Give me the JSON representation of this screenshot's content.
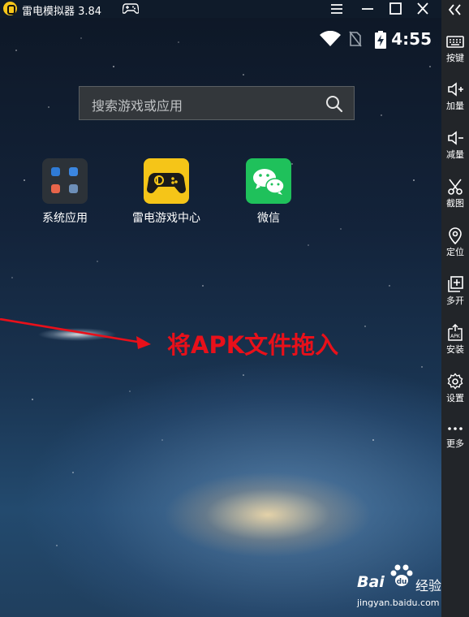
{
  "window": {
    "title": "雷电模拟器 3.84",
    "controls": [
      "menu-icon",
      "minimize-icon",
      "maximize-icon",
      "close-icon"
    ]
  },
  "status_bar": {
    "time": "4:55",
    "icons": [
      "wifi-icon",
      "no-sim-icon",
      "battery-charging-icon"
    ]
  },
  "search": {
    "placeholder": "搜索游戏或应用",
    "icon": "search-icon"
  },
  "apps": [
    {
      "label": "系统应用",
      "icon": "system-apps-folder-icon"
    },
    {
      "label": "雷电游戏中心",
      "icon": "ldplayer-game-center-icon",
      "color": "#f5c518"
    },
    {
      "label": "微信",
      "icon": "wechat-icon",
      "color": "#1fc15b"
    }
  ],
  "annotation": {
    "text": "将APK文件拖入",
    "color": "#e8101a"
  },
  "sidebar": {
    "items": [
      {
        "label": "按键",
        "icon": "keyboard-icon"
      },
      {
        "label": "加量",
        "icon": "volume-up-icon"
      },
      {
        "label": "减量",
        "icon": "volume-down-icon"
      },
      {
        "label": "截图",
        "icon": "scissors-icon"
      },
      {
        "label": "定位",
        "icon": "location-pin-icon"
      },
      {
        "label": "多开",
        "icon": "multi-instance-icon"
      },
      {
        "label": "安装",
        "icon": "apk-install-icon"
      },
      {
        "label": "设置",
        "icon": "gear-icon"
      },
      {
        "label": "更多",
        "icon": "more-dots-icon"
      }
    ]
  },
  "watermark": {
    "brand": "Bai",
    "brand_suffix": "经验",
    "url": "jingyan.baidu.com"
  }
}
